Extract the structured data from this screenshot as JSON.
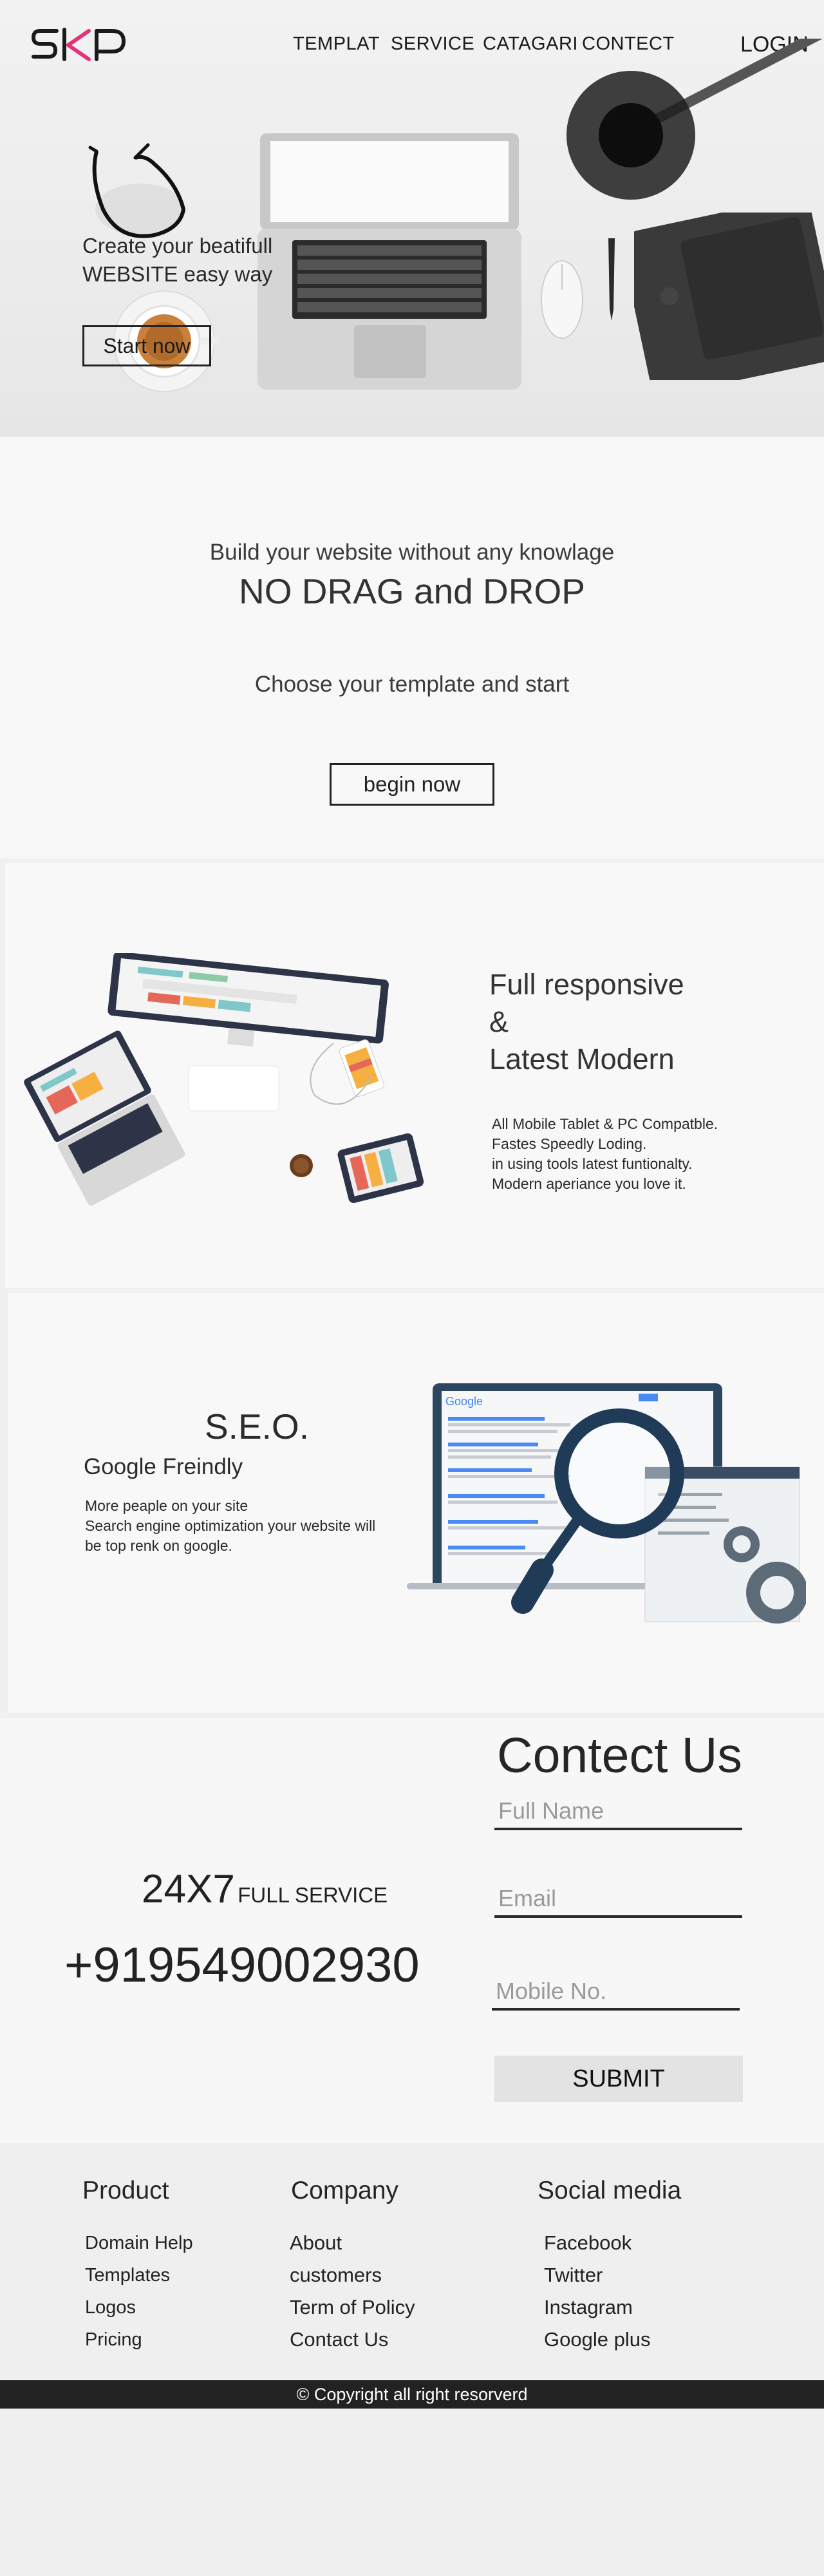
{
  "header": {
    "logo_alt": "SKP",
    "nav": [
      "TEMPLAT",
      "SERVICE",
      "CATAGARI",
      "CONTECT"
    ],
    "login_label": "LOGIN"
  },
  "hero": {
    "tagline_line1": "Create your beatifull",
    "tagline_line2": "WEBSITE easy way",
    "cta_label": "Start now"
  },
  "intro": {
    "subtitle": "Build your website without any knowlage",
    "title": "NO DRAG and DROP",
    "choose": "Choose your template and start",
    "cta_label": "begin now"
  },
  "responsive": {
    "title_line1": "Full responsive",
    "title_line2": "&",
    "title_line3": "Latest Modern",
    "desc": [
      "All Mobile Tablet & PC Compatble.",
      "Fastes Speedly Loding.",
      "in using tools latest funtionalty.",
      "Modern aperiance you love it."
    ]
  },
  "seo": {
    "title": "S.E.O.",
    "subtitle": "Google Freindly",
    "desc": [
      "More peaple on your site",
      "Search engine optimization your website will",
      "be top renk on google."
    ],
    "google_text": "Google"
  },
  "contact": {
    "title": "Contect Us",
    "fullname_placeholder": "Full Name",
    "email_placeholder": "Email",
    "mobile_placeholder": "Mobile No.",
    "submit_label": "SUBMIT",
    "service_big": "24X7",
    "service_small": "FULL SERVICE",
    "phone": "+919549002930"
  },
  "footer": {
    "product_title": "Product",
    "product_links": [
      "Domain Help",
      "Templates",
      "Logos",
      "Pricing"
    ],
    "company_title": "Company",
    "company_links": [
      "About",
      "customers",
      "Term of Policy",
      "Contact Us"
    ],
    "social_title": "Social media",
    "social_links": [
      "Facebook",
      "Twitter",
      "Instagram",
      "Google plus"
    ],
    "copyright": "© Copyright all right resorverd"
  },
  "colors": {
    "logo_black": "#1a1a1a",
    "logo_pink": "#e0357a",
    "copyright_bar": "#222222",
    "submit_bg": "#e3e3e3"
  }
}
